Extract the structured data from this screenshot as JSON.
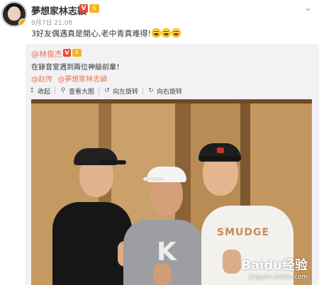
{
  "post": {
    "author": "夢想家林志穎",
    "verified_badge": "V",
    "level_badge": "6",
    "time": "9月7日 21:08",
    "content": "3好友偶遇真是開心,老中青真难得!"
  },
  "repost": {
    "author": "@林俊杰",
    "verified_badge": "V",
    "level_badge": "6",
    "text": "在錄音室遇到兩位神級前輩！",
    "mentions": [
      "@赵传",
      "@夢想家林志穎"
    ],
    "toolbar": {
      "collapse_label": "收起",
      "view_large_label": "查看大图",
      "rotate_left_label": "向左旋转",
      "rotate_right_label": "向右旋转"
    }
  },
  "photo": {
    "shirt_print": "SMUDGE",
    "shirt_letter": "K"
  },
  "watermark": {
    "main": "Baidu经验",
    "sub": "jingyan.baidu.com"
  },
  "colors": {
    "accent": "#eb7350",
    "verified": "#e9483a",
    "level": "#f7b320",
    "repost_bg": "#f2f2f5"
  },
  "icons": {
    "collapse": "arrow-up-icon",
    "view_large": "magnifier-icon",
    "rotate_left": "rotate-left-icon",
    "rotate_right": "rotate-right-icon",
    "more": "chevron-down-icon"
  }
}
